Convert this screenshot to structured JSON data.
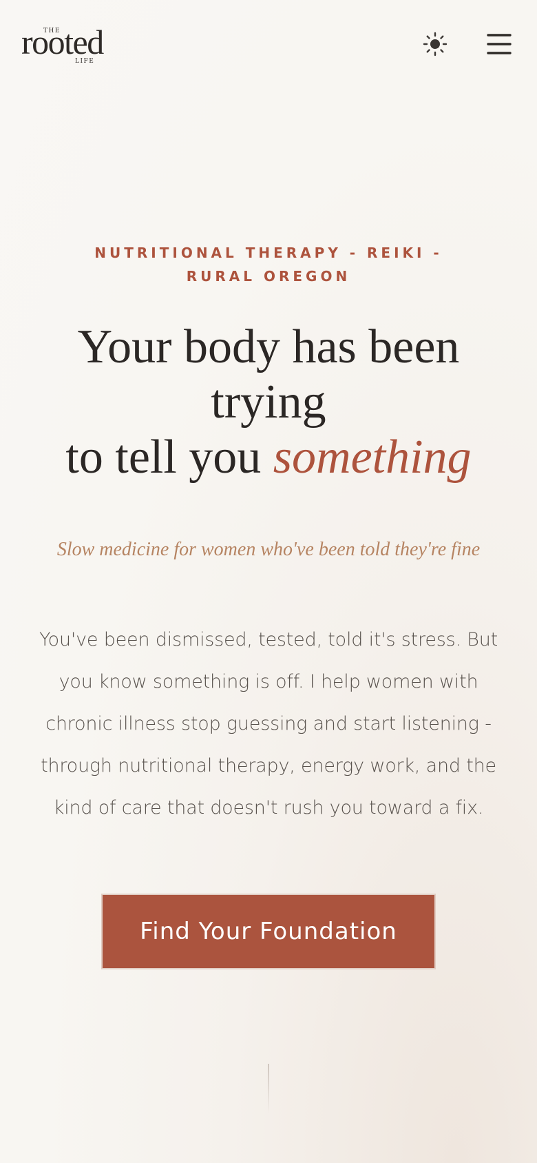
{
  "header": {
    "logo": {
      "top": "THE",
      "word": "rooted",
      "bottom": "LIFE"
    },
    "theme_toggle_icon": "sun-icon",
    "menu_icon": "hamburger-menu-icon"
  },
  "hero": {
    "eyebrow": "NUTRITIONAL THERAPY - REIKI - RURAL OREGON",
    "headline_line1": "Your body has been trying",
    "headline_line2_prefix": "to tell you ",
    "headline_accent": "something",
    "subtitle": "Slow medicine for women who've been told they're fine",
    "body": "You've been dismissed, tested, told it's stress. But you know something is off. I help women with chronic illness stop guessing and start listening - through nutritional therapy, energy work, and the kind of care that doesn't rush you toward a fix.",
    "cta_label": "Find Your Foundation"
  },
  "colors": {
    "accent": "#ab543e",
    "background": "#f8f6f2",
    "text": "#2b2725",
    "subtitle": "#b68462"
  }
}
